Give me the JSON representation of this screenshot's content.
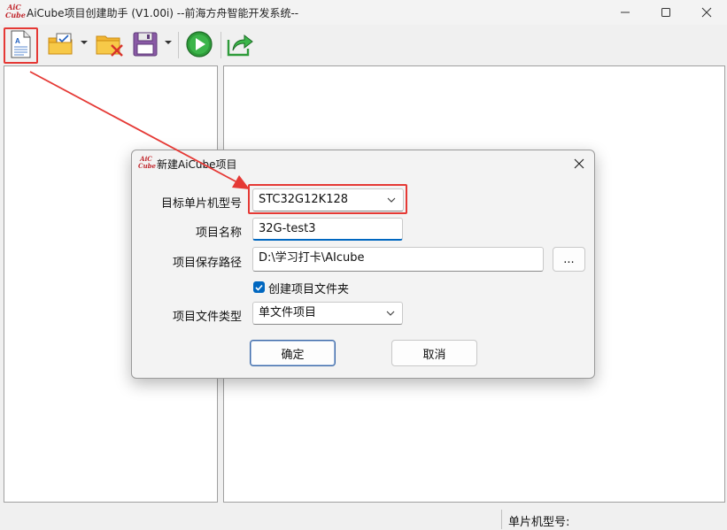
{
  "window": {
    "logo_text": "AiC Cube",
    "title": "AiCube项目创建助手 (V1.00i) --前海方舟智能开发系统--"
  },
  "toolbar": {
    "icons": [
      "new-project-icon",
      "open-project-icon",
      "delete-project-icon",
      "save-icon",
      "run-icon",
      "export-icon"
    ],
    "highlight_color": "#e53935"
  },
  "statusbar": {
    "mcu_label": "单片机型号:"
  },
  "dialog": {
    "logo_text": "AiC Cube",
    "title": "新建AiCube项目",
    "target_mcu": {
      "label": "目标单片机型号",
      "value": "STC32G12K128"
    },
    "project_name": {
      "label": "项目名称",
      "value": "32G-test3"
    },
    "save_path": {
      "label": "项目保存路径",
      "value": "D:\\学习打卡\\AIcube",
      "browse_label": "..."
    },
    "create_folder": {
      "label": "创建项目文件夹",
      "checked": true
    },
    "file_type": {
      "label": "项目文件类型",
      "value": "单文件项目"
    },
    "ok_label": "确定",
    "cancel_label": "取消"
  },
  "colors": {
    "accent": "#0067c0",
    "annotation": "#e53935"
  }
}
